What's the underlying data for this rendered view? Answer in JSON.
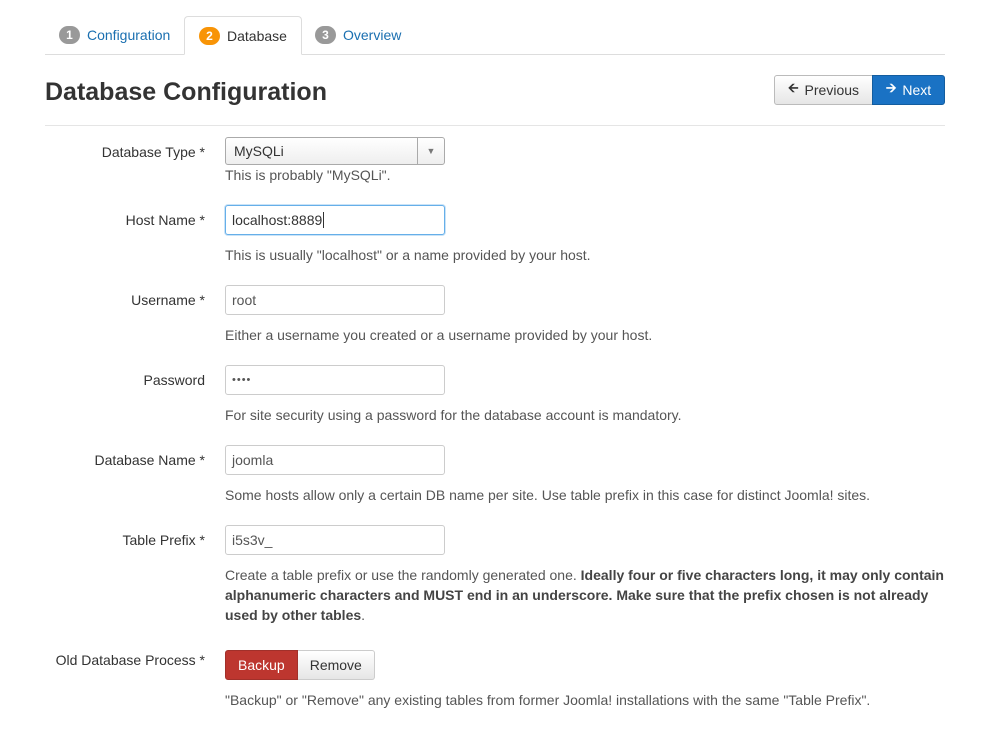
{
  "tabs": [
    {
      "num": "1",
      "label": "Configuration"
    },
    {
      "num": "2",
      "label": "Database"
    },
    {
      "num": "3",
      "label": "Overview"
    }
  ],
  "header": {
    "title": "Database Configuration",
    "prev_label": "Previous",
    "next_label": "Next"
  },
  "form": {
    "db_type": {
      "label": "Database Type *",
      "value": "MySQLi",
      "help": "This is probably \"MySQLi\"."
    },
    "host": {
      "label": "Host Name *",
      "value": "localhost:8889",
      "help": "This is usually \"localhost\" or a name provided by your host."
    },
    "username": {
      "label": "Username *",
      "value": "root",
      "help": "Either a username you created or a username provided by your host."
    },
    "password": {
      "label": "Password",
      "value": "••••",
      "help": "For site security using a password for the database account is mandatory."
    },
    "db_name": {
      "label": "Database Name *",
      "value": "joomla",
      "help": "Some hosts allow only a certain DB name per site. Use table prefix in this case for distinct Joomla! sites."
    },
    "prefix": {
      "label": "Table Prefix *",
      "value": "i5s3v_",
      "help_plain": "Create a table prefix or use the randomly generated one. ",
      "help_bold": "Ideally four or five characters long, it may only contain alphanumeric characters and MUST end in an underscore. Make sure that the prefix chosen is not already used by other tables",
      "help_end": "."
    },
    "old_db": {
      "label": "Old Database Process *",
      "options": [
        "Backup",
        "Remove"
      ],
      "selected": "Backup",
      "help": "\"Backup\" or \"Remove\" any existing tables from former Joomla! installations with the same \"Table Prefix\"."
    }
  },
  "colors": {
    "link": "#1a6fb0",
    "active_badge": "#f89406",
    "next_button": "#1a72c4",
    "backup_button": "#bd362f"
  }
}
